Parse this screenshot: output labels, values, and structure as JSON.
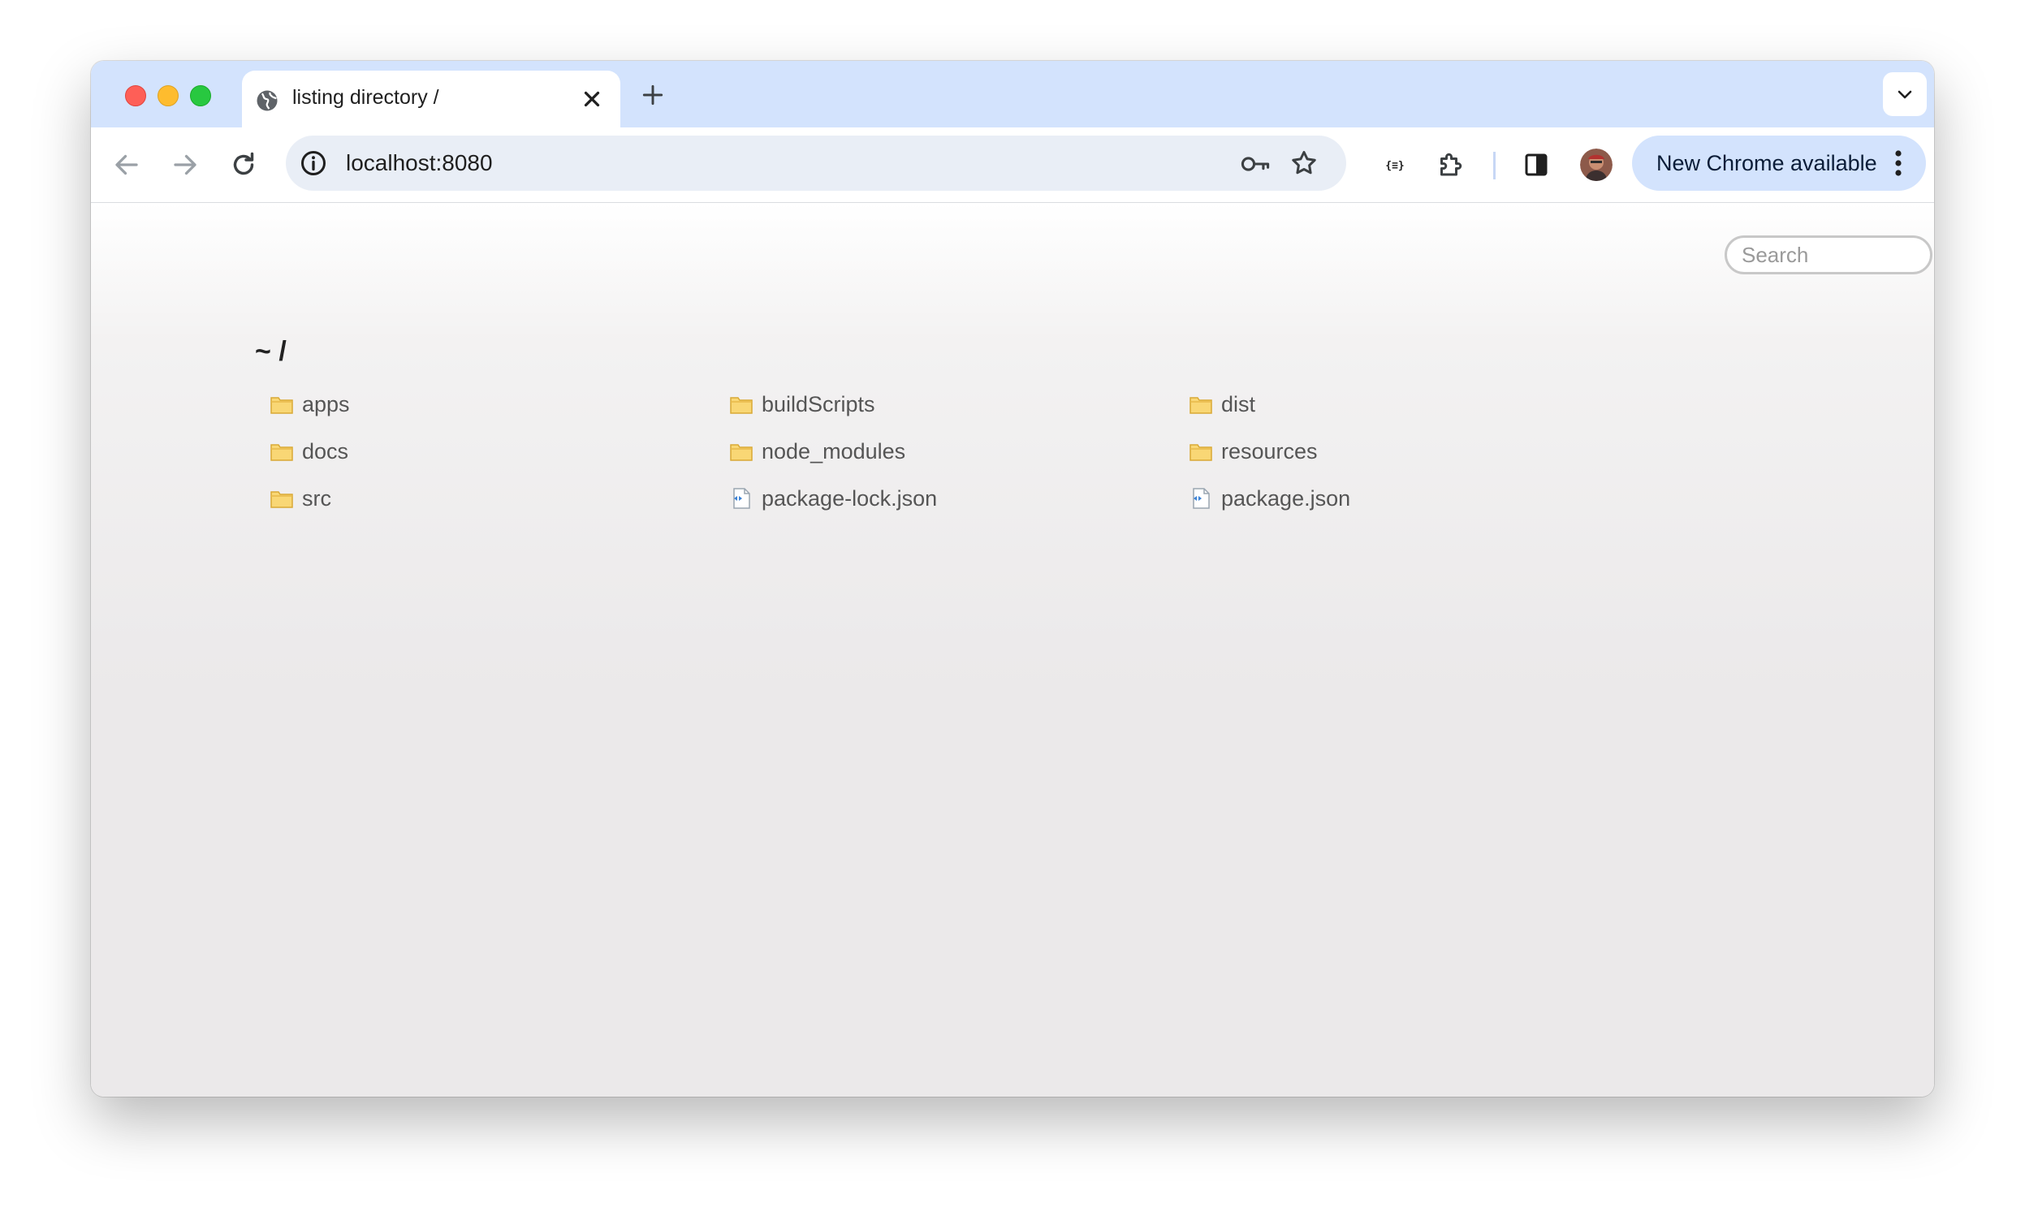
{
  "browser": {
    "tab": {
      "title": "listing directory /"
    },
    "omnibox": {
      "url": "localhost:8080"
    },
    "update_chip": {
      "label": "New Chrome available"
    },
    "colors": {
      "tabstrip": "#d3e3fd",
      "omnibox": "#e9eef6",
      "update_chip": "#d3e3fd"
    },
    "icons": [
      "back-arrow-icon",
      "forward-arrow-icon",
      "reload-icon",
      "site-info-icon",
      "password-key-icon",
      "bookmark-star-icon",
      "json-viewer-extension-icon",
      "extensions-puzzle-icon",
      "side-panel-icon",
      "profile-avatar",
      "more-menu-icon"
    ]
  },
  "page": {
    "search": {
      "placeholder": "Search"
    },
    "breadcrumb": {
      "home": "~",
      "separator": "/"
    },
    "files": [
      {
        "name": "apps",
        "kind": "folder"
      },
      {
        "name": "buildScripts",
        "kind": "folder"
      },
      {
        "name": "dist",
        "kind": "folder"
      },
      {
        "name": "docs",
        "kind": "folder"
      },
      {
        "name": "node_modules",
        "kind": "folder"
      },
      {
        "name": "resources",
        "kind": "folder"
      },
      {
        "name": "src",
        "kind": "folder"
      },
      {
        "name": "package-lock.json",
        "kind": "json-file"
      },
      {
        "name": "package.json",
        "kind": "json-file"
      }
    ]
  }
}
